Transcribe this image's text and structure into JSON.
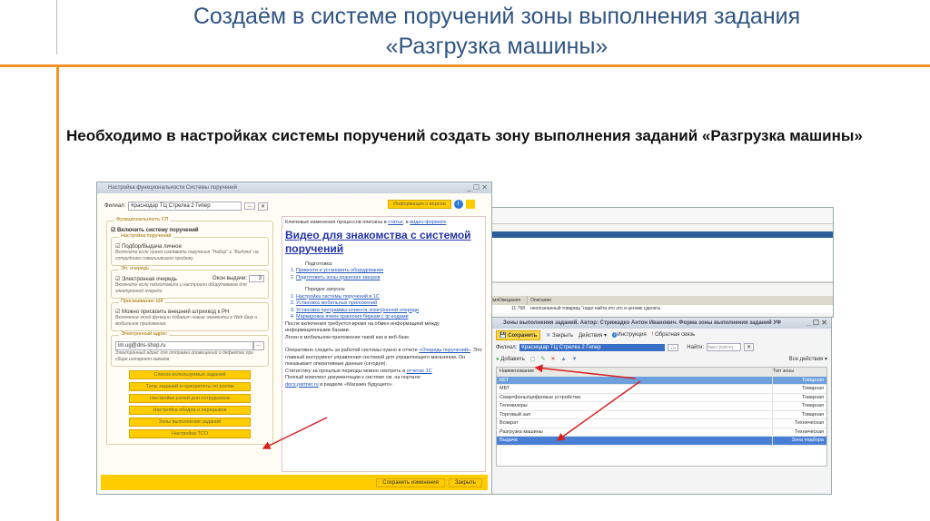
{
  "slide": {
    "title_line1": "Создаём в системе поручений зоны выполнения задания",
    "title_line2": "«Разгрузка машины»",
    "intro": "Необходимо в настройках системы поручений создать зону выполнения заданий «Разгрузка машины»"
  },
  "settings": {
    "title": "Настройка функциональности Системы поручений",
    "branch_label": "Филиал:",
    "branch_value": "Краснодар ТЦ Стрелка 2 Гипер",
    "info_btn": "Информация о версии",
    "grp_func": "Функциональность СП",
    "enable": "Включить систему поручений",
    "grp_tasks": "Настройка поручений",
    "pick": "Подбор/Выдача личное",
    "pick_hint": "Включите если нужно создавать поручения \"Набор\" и \"Выдача\" на сотрудника совершившего продажу.",
    "grp_queue": "Эл. очередь",
    "queue": "Электронная очередь",
    "windows_label": "Окон выдачи:",
    "windows_value": "3",
    "queue_hint": "Включите если подготовили и настроили оборудование для электронной очереди",
    "grp_bc": "Присваивание ШК",
    "bc": "Можно присвоить внешний штрихкод к РН",
    "bc_hint": "Включение этой функции добавит новые элементы в Web базу и мобильное приложение.",
    "grp_mail": "Электронный адрес",
    "mail": "im.ug@dns-shop.ru",
    "mail_hint": "Электронный адрес для отправки оповещений о дефектах при сборе интернет-заказов",
    "buttons": [
      "Список используемых заданий",
      "Типы заданий и приоритеты по ролям",
      "Настройки ролей для сотрудников",
      "Настройка обедов и перерывов",
      "Зоны выполнения заданий",
      "Настройка ТСО"
    ],
    "save": "Сохранить изменения",
    "close": "Закрыть",
    "info": {
      "intro_a": "Ключевые изменения процессов описаны в",
      "link_article": "статье",
      "intro_b": ", в",
      "link_video": "видео-формате",
      "video_title": "Видео для знакомства с системой поручений",
      "prep": "Подготовка:",
      "prep_items": [
        "Привезти и установить оборудование",
        "Подготовить зоны хранения заказов"
      ],
      "launch": "Порядок запуска:",
      "launch_items": [
        "Настройка системы поручений в 1С",
        "Установка мобильных приложений",
        "Установка программы-клиента электронной очереди",
        "Маркировка ячеек хранения биркам с qr-кодами"
      ],
      "p1": "После включения требуется время на обмен информацией между информационными базами.",
      "p1b": "Логин в мобильном приложении такой как в веб-базе.",
      "p2a": "Оперативно следить за работой системы нужно в отчете",
      "link_report": "«Очередь поручений»",
      "p2b": ". Это главный инструмент управления системой для управляющего магазином. Он показывает оперативные данные (сегодня).",
      "p3a": "Статистику за прошлые периоды можно смотреть в",
      "link_reports": "отчетах 1С",
      "p3b": "Полный комплект документации к системе см. на портале",
      "link_docs": "docs.partner.ru",
      "p3c": "в разделе «Магазин будущего»"
    }
  },
  "bgwin": {
    "col1": "ВремяОжидания",
    "col2": "Описание",
    "val": "11 768",
    "desc": "неопознанный товарищ \"надо найти кто это и ценник сделать"
  },
  "zones": {
    "title": "Зоны выполнения заданий. Автор: Стрижадко Антон Иванович. Форма зоны выполнения заданий УФ",
    "save": "Сохранить",
    "close": "Закрыть",
    "actions": "Действия",
    "help": "Инструкция",
    "feedback": "Обратная связь",
    "branch_label": "Филиал:",
    "branch_value": "Краснодар ТЦ Стрелка 2 Гипер",
    "find_label": "Найти:",
    "find_placeholder": "Текст (Ctrl+F)",
    "add": "Добавить",
    "all_actions": "Все действия",
    "col_name": "Наименование",
    "col_type": "Тип зоны",
    "rows": [
      {
        "name": "КБТ",
        "type": "Товарная"
      },
      {
        "name": "МБТ",
        "type": "Товарная"
      },
      {
        "name": "Смартфоны/цифровые устройства",
        "type": "Товарная"
      },
      {
        "name": "Телевизоры",
        "type": "Товарная"
      },
      {
        "name": "Торговый зал",
        "type": "Товарная"
      },
      {
        "name": "Возврат",
        "type": "Техническая"
      },
      {
        "name": "Разгрузка машины",
        "type": "Техническая"
      },
      {
        "name": "Выдача",
        "type": "Зона подбора"
      }
    ]
  }
}
